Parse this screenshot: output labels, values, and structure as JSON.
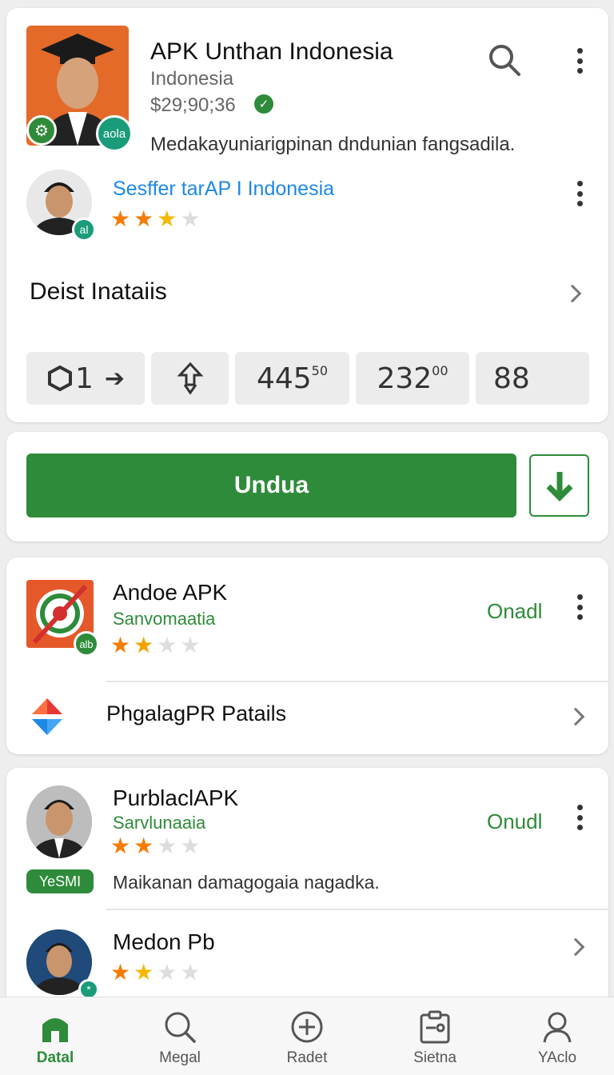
{
  "header_card": {
    "app_title": "APK Unthan Indonesia",
    "country": "Indonesia",
    "price": "$29;90;36",
    "description": "Medakayuniarigpinan dndunian fangsadila.",
    "avatar_badge_right": "aola",
    "publisher": {
      "name": "Sesffer tarAP I Indonesia",
      "badge": "al",
      "rating": 2.5
    },
    "details_label": "Deist Inataiis",
    "stats": [
      {
        "label": "1",
        "icon": "shield-icon"
      },
      {
        "label": "",
        "icon": "share-arrows-icon"
      },
      {
        "label": "445",
        "sup": "50"
      },
      {
        "label": "232",
        "sup": "00"
      },
      {
        "label": "88"
      }
    ]
  },
  "download_card": {
    "button_label": "Undua",
    "icon": "download-arrow-icon"
  },
  "list": [
    {
      "name": "Andoe APK",
      "subtitle": "Sanvomaatia",
      "action": "Onadl",
      "badge": "alb",
      "rating": 2,
      "icon": "app-logo-icon",
      "sub_row": {
        "label": "PhgalagPR Patails",
        "icon": "diamond-logo-icon"
      }
    },
    {
      "name": "PurblaclAPK",
      "subtitle": "Sarvlunaaia",
      "action": "Onudl",
      "rating": 2,
      "tag": "YeSMI",
      "description": "Maikanan damagogaia nagadka."
    },
    {
      "name": "Medon Pb",
      "rating": 2,
      "badge": "*"
    }
  ],
  "bottom_nav": [
    {
      "label": "Datal",
      "icon": "home-icon",
      "active": true
    },
    {
      "label": "Megal",
      "icon": "search-icon",
      "active": false
    },
    {
      "label": "Radet",
      "icon": "plus-circle-icon",
      "active": false
    },
    {
      "label": "Sietna",
      "icon": "clipboard-icon",
      "active": false
    },
    {
      "label": "YAclo",
      "icon": "person-icon",
      "active": false
    }
  ],
  "colors": {
    "accent": "#2e8b3a",
    "link": "#1e88e5",
    "star": "#f57c00"
  }
}
